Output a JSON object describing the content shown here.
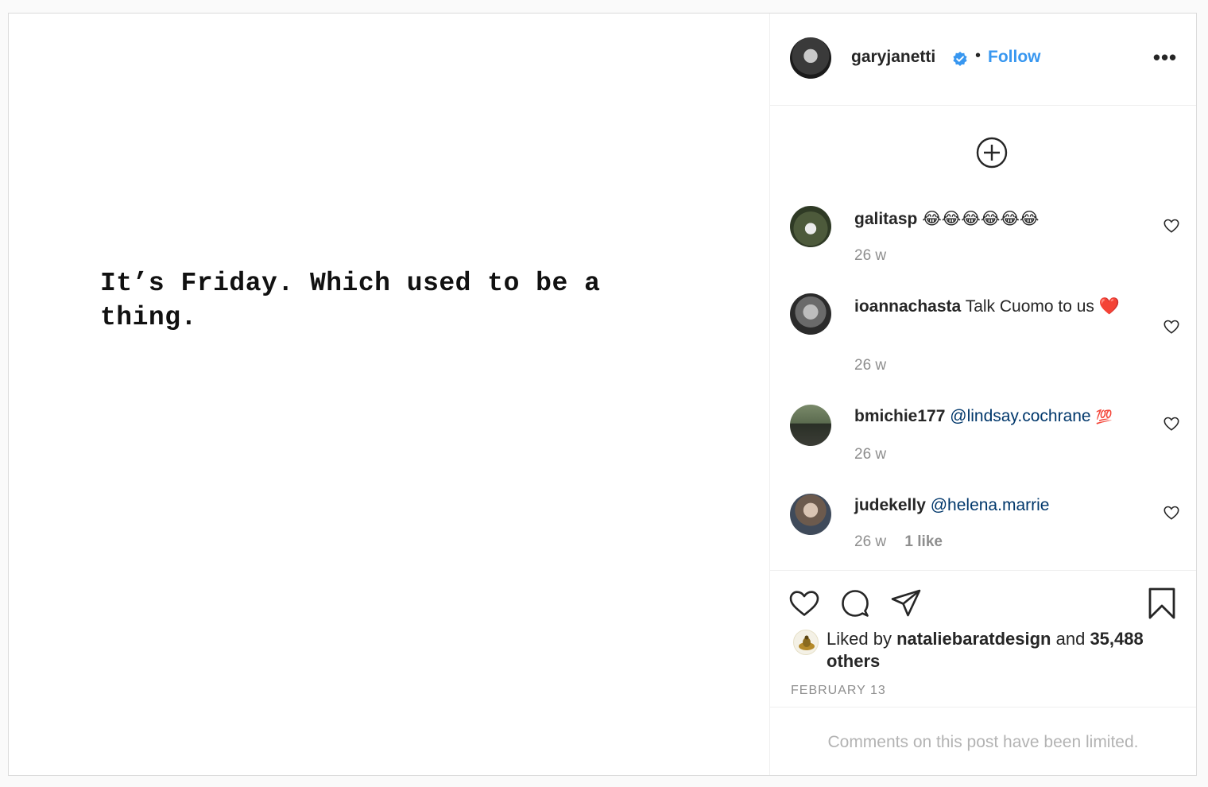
{
  "post": {
    "image_text": "It’s Friday. Which used to be a thing."
  },
  "header": {
    "username": "garyjanetti",
    "separator": "•",
    "follow_label": "Follow",
    "more_label": "•••"
  },
  "comments": [
    {
      "username": "galitasp",
      "text": "😂😂😂😂😂😂",
      "mention": "",
      "emoji": "",
      "time": "26 w",
      "likes": ""
    },
    {
      "username": "ioannachasta",
      "text": "Talk Cuomo to us",
      "mention": "",
      "emoji": "❤️",
      "time": "26 w",
      "likes": ""
    },
    {
      "username": "bmichie177",
      "text": "",
      "mention": "@lindsay.cochrane",
      "emoji": "💯",
      "time": "26 w",
      "likes": ""
    },
    {
      "username": "judekelly",
      "text": "",
      "mention": "@helena.marrie",
      "emoji": "",
      "time": "26 w",
      "likes": "1 like"
    }
  ],
  "likes": {
    "prefix": "Liked by",
    "user": "nataliebaratdesign",
    "joiner": "and",
    "others": "35,488 others"
  },
  "date": "FEBRUARY 13",
  "footer": {
    "notice": "Comments on this post have been limited."
  },
  "colors": {
    "link_blue": "#3897f0",
    "mention_blue": "#00376b",
    "muted": "#8e8e8e"
  }
}
